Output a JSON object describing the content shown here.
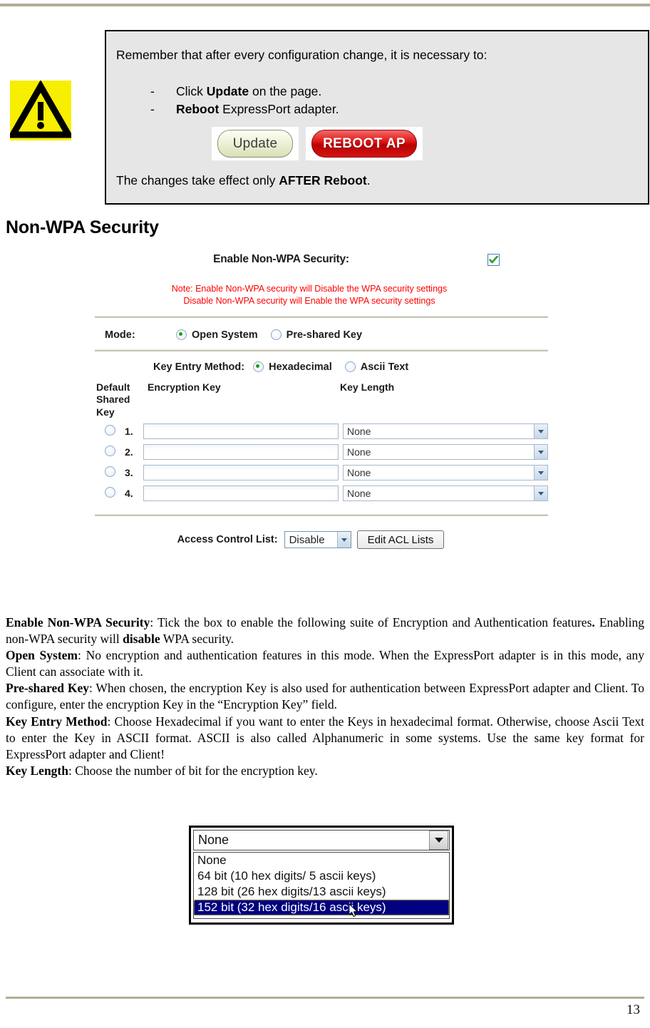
{
  "page": {
    "number": "13"
  },
  "warning_callout": {
    "icon": "warning-triangle-icon",
    "intro": "Remember that after every configuration change, it is necessary to:",
    "steps": [
      {
        "dash": "-",
        "pre": "Click ",
        "bold": "Update",
        "post": " on the page."
      },
      {
        "dash": "-",
        "pre": "",
        "bold": "Reboot",
        "post": " ExpressPort adapter."
      }
    ],
    "buttons": {
      "update_label": "Update",
      "reboot_label": "REBOOT AP"
    },
    "footer_pre": "The changes take effect only ",
    "footer_bold": "AFTER Reboot",
    "footer_post": "."
  },
  "heading": "Non-WPA Security",
  "form": {
    "enable_label": "Enable Non-WPA Security:",
    "enable_checked": true,
    "note_line1": "Note: Enable Non-WPA security will Disable the WPA security settings",
    "note_line2": "Disable Non-WPA security will Enable the WPA security settings",
    "mode_label": "Mode:",
    "mode_options": [
      {
        "label": "Open System",
        "selected": true
      },
      {
        "label": "Pre-shared Key",
        "selected": false
      }
    ],
    "key_entry_label": "Key Entry Method:",
    "key_entry_options": [
      {
        "label": "Hexadecimal",
        "selected": true
      },
      {
        "label": "Ascii Text",
        "selected": false
      }
    ],
    "columns": {
      "default_shared_key": "Default Shared Key",
      "encryption_key": "Encryption Key",
      "key_length": "Key Length"
    },
    "rows": [
      {
        "num": "1.",
        "selected": false,
        "key_value": "",
        "key_length": "None"
      },
      {
        "num": "2.",
        "selected": false,
        "key_value": "",
        "key_length": "None"
      },
      {
        "num": "3.",
        "selected": false,
        "key_value": "",
        "key_length": "None"
      },
      {
        "num": "4.",
        "selected": false,
        "key_value": "",
        "key_length": "None"
      }
    ],
    "acl_label": "Access Control List:",
    "acl_value": "Disable",
    "acl_button": "Edit ACL Lists"
  },
  "descriptions": {
    "p1_bold": "Enable Non-WPA Security",
    "p1_text": ": Tick the box to enable the following suite of Encryption and Authentication features",
    "p1_bold2": ".",
    "p1_text2": " Enabling non-WPA security will ",
    "p1_bold3": "disable",
    "p1_text3": " WPA security.",
    "p2_bold": "Open System",
    "p2_text": ": No encryption and authentication features in this mode. When the ExpressPort adapter is in this mode, any Client can associate with it.",
    "p3_bold": "Pre-shared Key",
    "p3_text": ": When chosen, the encryption Key is also used for authentication between ExpressPort adapter and Client. To configure, enter the encryption Key in the “Encryption Key” field.",
    "p4_bold": "Key Entry Method",
    "p4_text": ": Choose Hexadecimal if you want to enter the Keys in hexadecimal format. Otherwise, choose Ascii Text to enter the Key in ASCII format. ASCII is also called Alphanumeric in some systems. Use the same key format for ExpressPort adapter and Client!",
    "p5_bold": "Key Length",
    "p5_text": ": Choose the number of bit for the encryption key."
  },
  "dropdown_figure": {
    "selected_value": "None",
    "options": [
      {
        "label": "None",
        "highlighted": false
      },
      {
        "label": "64 bit (10 hex digits/ 5 ascii keys)",
        "highlighted": false
      },
      {
        "label": "128 bit (26 hex digits/13 ascii keys)",
        "highlighted": false
      },
      {
        "label": "152 bit (32 hex digits/16 ascii keys)",
        "highlighted": true
      }
    ]
  }
}
